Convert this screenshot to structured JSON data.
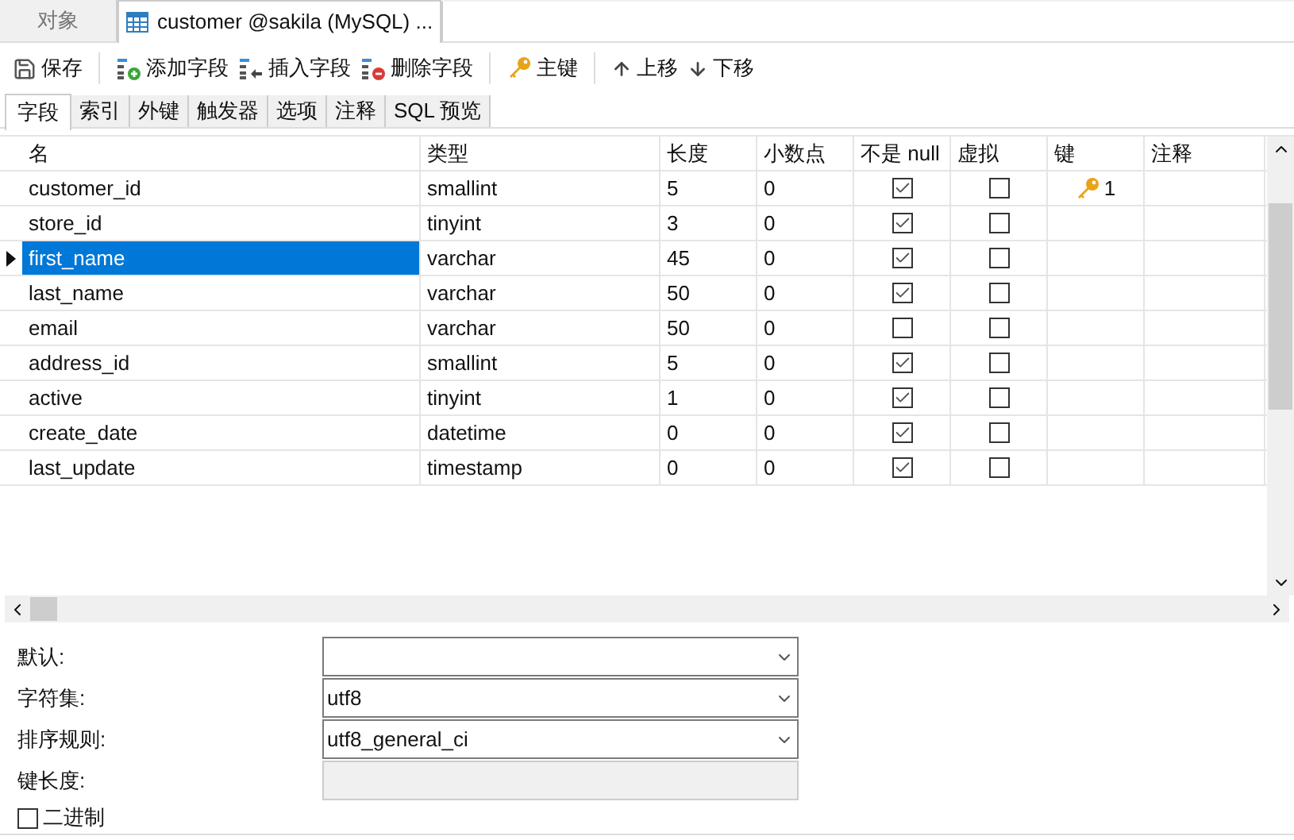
{
  "doc_tabs": [
    {
      "label": "对象",
      "selected": false
    },
    {
      "label": "customer @sakila (MySQL) ...",
      "selected": true
    }
  ],
  "toolbar": [
    {
      "kind": "save",
      "label": "保存"
    },
    {
      "kind": "add",
      "label": "添加字段"
    },
    {
      "kind": "insert",
      "label": "插入字段"
    },
    {
      "kind": "delete",
      "label": "删除字段"
    },
    {
      "kind": "key",
      "label": "主键"
    },
    {
      "kind": "up",
      "label": "上移"
    },
    {
      "kind": "down",
      "label": "下移"
    }
  ],
  "tabs": [
    {
      "label": "字段",
      "selected": true
    },
    {
      "label": "索引",
      "selected": false
    },
    {
      "label": "外键",
      "selected": false
    },
    {
      "label": "触发器",
      "selected": false
    },
    {
      "label": "选项",
      "selected": false
    },
    {
      "label": "注释",
      "selected": false
    },
    {
      "label": "SQL 预览",
      "selected": false
    }
  ],
  "table": {
    "columns": [
      "名",
      "类型",
      "长度",
      "小数点",
      "不是 null",
      "虚拟",
      "键",
      "注释"
    ],
    "rows": [
      {
        "name": "customer_id",
        "type": "smallint",
        "length": "5",
        "decimals": "0",
        "not_null": true,
        "virtual": false,
        "key": "1",
        "selected": false
      },
      {
        "name": "store_id",
        "type": "tinyint",
        "length": "3",
        "decimals": "0",
        "not_null": true,
        "virtual": false,
        "selected": false
      },
      {
        "name": "first_name",
        "type": "varchar",
        "length": "45",
        "decimals": "0",
        "not_null": true,
        "virtual": false,
        "selected": true
      },
      {
        "name": "last_name",
        "type": "varchar",
        "length": "50",
        "decimals": "0",
        "not_null": true,
        "virtual": false,
        "selected": false
      },
      {
        "name": "email",
        "type": "varchar",
        "length": "50",
        "decimals": "0",
        "not_null": false,
        "virtual": false,
        "selected": false
      },
      {
        "name": "address_id",
        "type": "smallint",
        "length": "5",
        "decimals": "0",
        "not_null": true,
        "virtual": false,
        "selected": false
      },
      {
        "name": "active",
        "type": "tinyint",
        "length": "1",
        "decimals": "0",
        "not_null": true,
        "virtual": false,
        "selected": false
      },
      {
        "name": "create_date",
        "type": "datetime",
        "length": "0",
        "decimals": "0",
        "not_null": true,
        "virtual": false,
        "selected": false
      },
      {
        "name": "last_update",
        "type": "timestamp",
        "length": "0",
        "decimals": "0",
        "not_null": true,
        "virtual": false,
        "selected": false
      }
    ]
  },
  "properties": [
    {
      "label": "默认:",
      "kind": "dropdown"
    },
    {
      "label": "字符集:",
      "kind": "dropdown",
      "value": "utf8"
    },
    {
      "label": "排序规则:",
      "kind": "dropdown",
      "value": "utf8_general_ci"
    },
    {
      "label": "键长度:",
      "kind": "disabled"
    }
  ],
  "binary": {
    "label": "二进制",
    "checked": false
  }
}
